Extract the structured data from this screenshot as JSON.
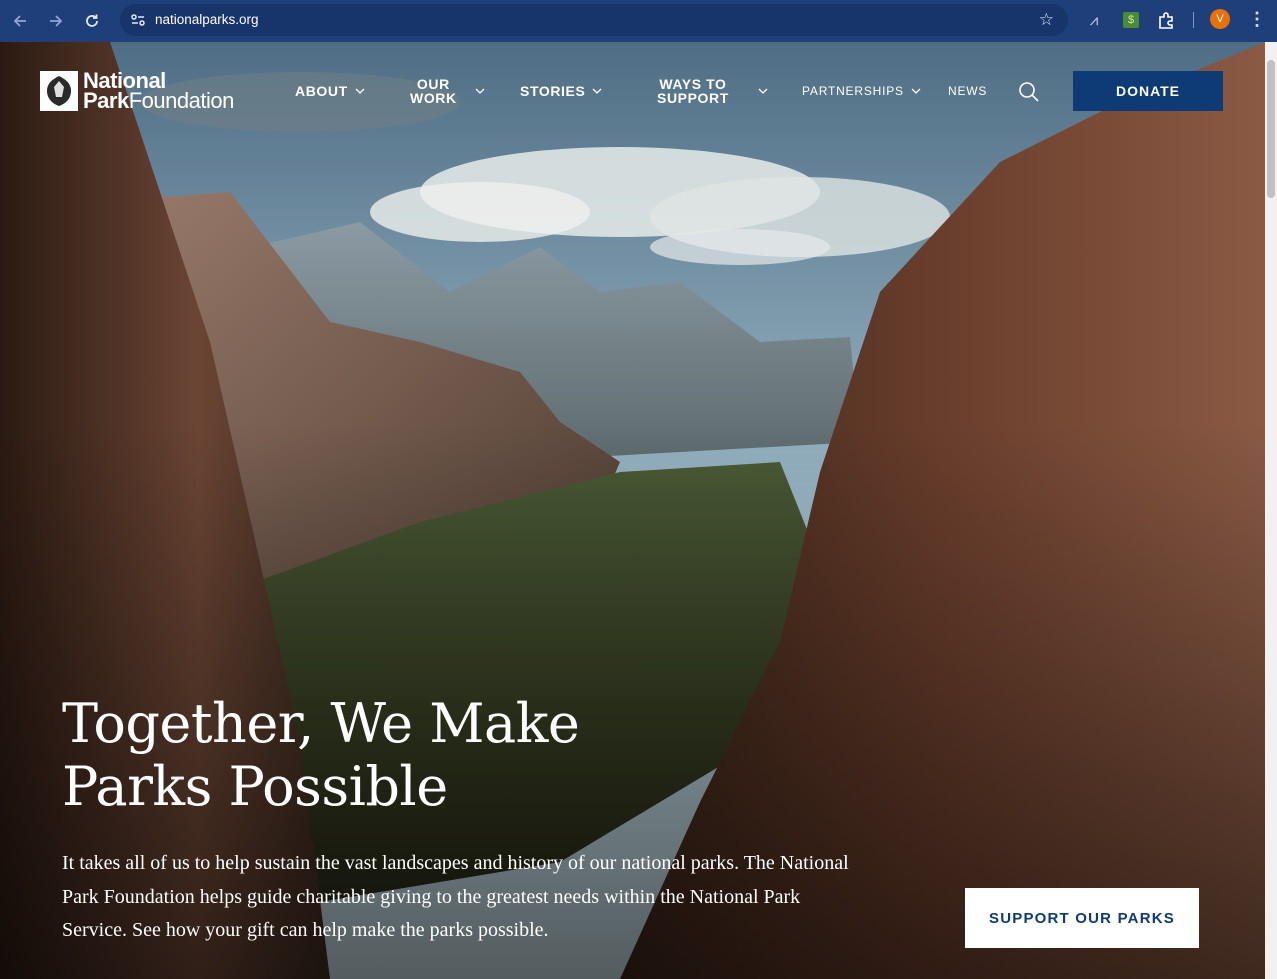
{
  "browser": {
    "url": "nationalparks.org",
    "avatar_letter": "V",
    "icons": [
      "back-arrow-icon",
      "forward-arrow-icon",
      "reload-icon",
      "site-info-icon",
      "bookmark-star-icon",
      "extension-icon",
      "profile-avatar",
      "menu-kebab-icon"
    ]
  },
  "header": {
    "logo_line1": "National",
    "logo_line2_bold": "Park",
    "logo_line2_rest": "Foundation",
    "nav": {
      "about": "ABOUT",
      "our_work_1": "OUR",
      "our_work_2": "WORK",
      "stories": "STORIES",
      "ways_1": "WAYS TO",
      "ways_2": "SUPPORT",
      "partnerships": "PARTNERSHIPS",
      "news": "NEWS"
    },
    "donate": "DONATE"
  },
  "hero": {
    "headline_1": "Together, We Make",
    "headline_2": "Parks Possible",
    "body": "It takes all of us to help sustain the vast landscapes and history of our national parks. The National Park Foundation helps guide charitable giving to the greatest needs within the National Park Service. See how your gift can help make the parks possible.",
    "cta": "SUPPORT OUR PARKS"
  },
  "colors": {
    "chrome": "#1f3f7a",
    "brand_blue": "#0e3a75",
    "white": "#ffffff"
  }
}
